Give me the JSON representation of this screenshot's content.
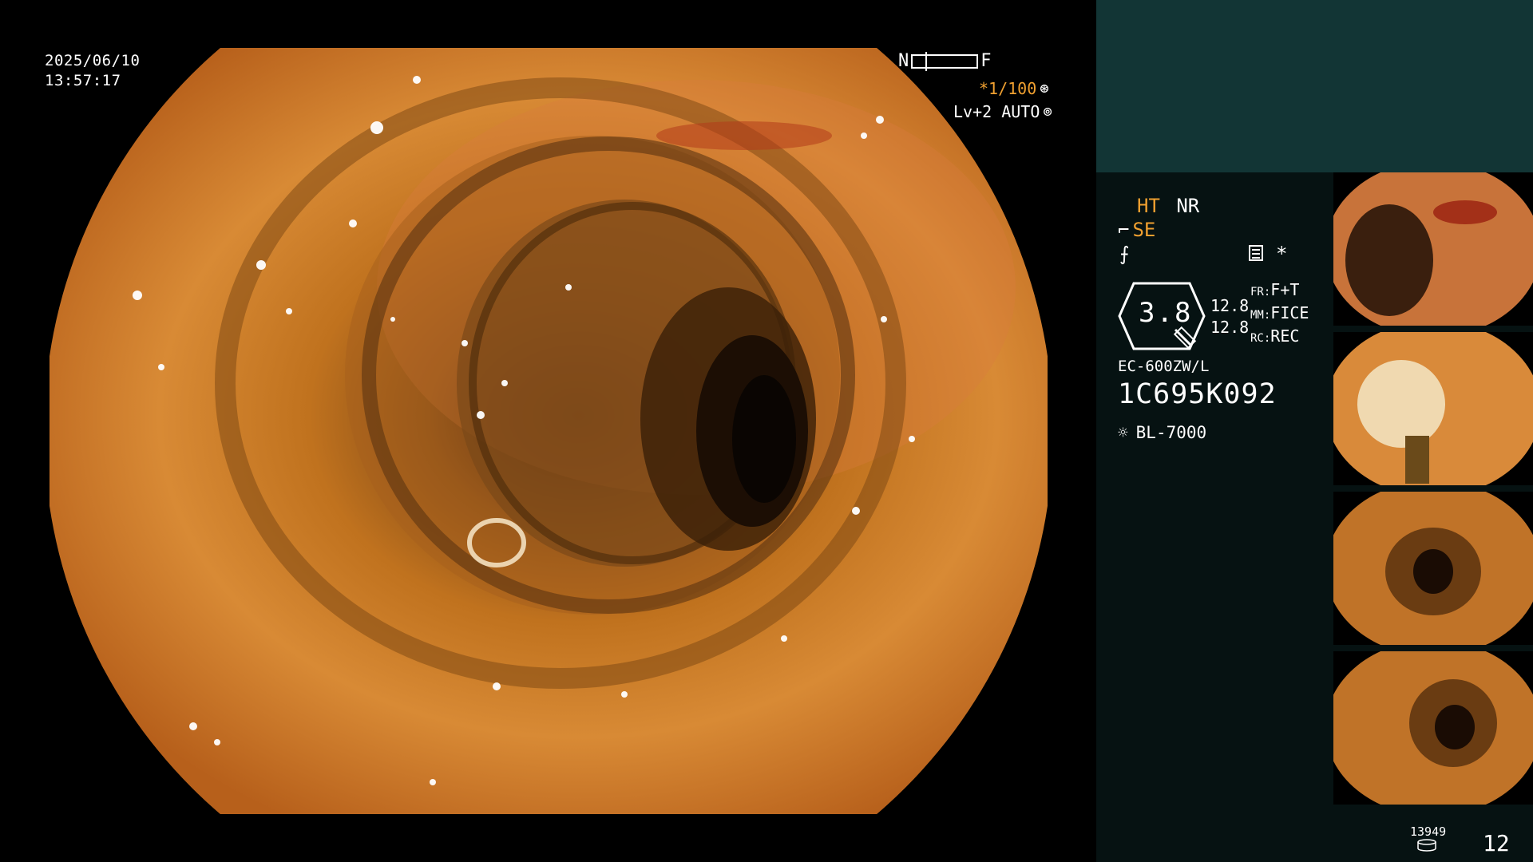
{
  "datetime": {
    "date": "2025/06/10",
    "time": "13:57:17"
  },
  "overlay": {
    "near_label": "N",
    "far_label": "F",
    "shutter": "*1/100",
    "level": "Lv+2 AUTO"
  },
  "panel": {
    "ht": "HT",
    "nr": "NR",
    "se": "SE",
    "star": "*",
    "gauge_value": "3.8",
    "values": [
      "12.8",
      "12.8"
    ],
    "modes": [
      {
        "key": "FR:",
        "value": "F+T"
      },
      {
        "key": "MM:",
        "value": "FICE"
      },
      {
        "key": "RC:",
        "value": "REC"
      }
    ],
    "scope_model": "EC-600ZW/L",
    "serial": "1C695K092",
    "light_source": "BL-7000",
    "counter_small": "13949",
    "counter_big": "12"
  },
  "colors": {
    "panel_bg": "#061212",
    "panel_top": "#123535",
    "accent_orange": "#f0a030"
  },
  "thumbnails": [
    {
      "name": "thumb-1"
    },
    {
      "name": "thumb-2"
    },
    {
      "name": "thumb-3"
    },
    {
      "name": "thumb-4"
    }
  ]
}
